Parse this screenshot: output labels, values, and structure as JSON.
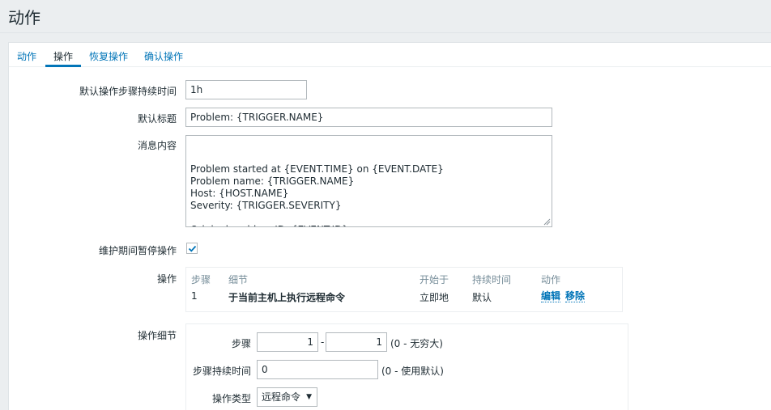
{
  "page": {
    "title": "动作"
  },
  "tabs": [
    {
      "label": "动作"
    },
    {
      "label": "操作"
    },
    {
      "label": "恢复操作"
    },
    {
      "label": "确认操作"
    }
  ],
  "form": {
    "default_step_duration": {
      "label": "默认操作步骤持续时间",
      "value": "1h"
    },
    "default_subject": {
      "label": "默认标题",
      "value": "Problem: {TRIGGER.NAME}"
    },
    "default_message": {
      "label": "消息内容",
      "value": "Problem started at {EVENT.TIME} on {EVENT.DATE}\nProblem name: {TRIGGER.NAME}\nHost: {HOST.NAME}\nSeverity: {TRIGGER.SEVERITY}\n\nOriginal problem ID: {EVENT.ID}\n{TRIGGER.URL}"
    },
    "pause_maintenance": {
      "label": "维护期间暂停操作",
      "checked": true
    }
  },
  "operations": {
    "label": "操作",
    "headers": {
      "steps": "步骤",
      "details": "细节",
      "start_in": "开始于",
      "duration": "持续时间",
      "action": "动作"
    },
    "rows": [
      {
        "step": "1",
        "details": "于当前主机上执行远程命令",
        "start_in": "立即地",
        "duration": "默认",
        "edit": "编辑",
        "remove": "移除"
      }
    ]
  },
  "operation_details": {
    "label": "操作细节",
    "steps": {
      "label": "步骤",
      "from": "1",
      "separator": "-",
      "to": "1",
      "hint": "(0 - 无穷大)"
    },
    "step_duration": {
      "label": "步骤持续时间",
      "value": "0",
      "hint": "(0 - 使用默认)"
    },
    "operation_type": {
      "label": "操作类型",
      "value": "远程命令"
    }
  },
  "colors": {
    "accent": "#0275b8",
    "text": "#1f2c33",
    "muted": "#768d99",
    "background": "#ebeef0"
  }
}
